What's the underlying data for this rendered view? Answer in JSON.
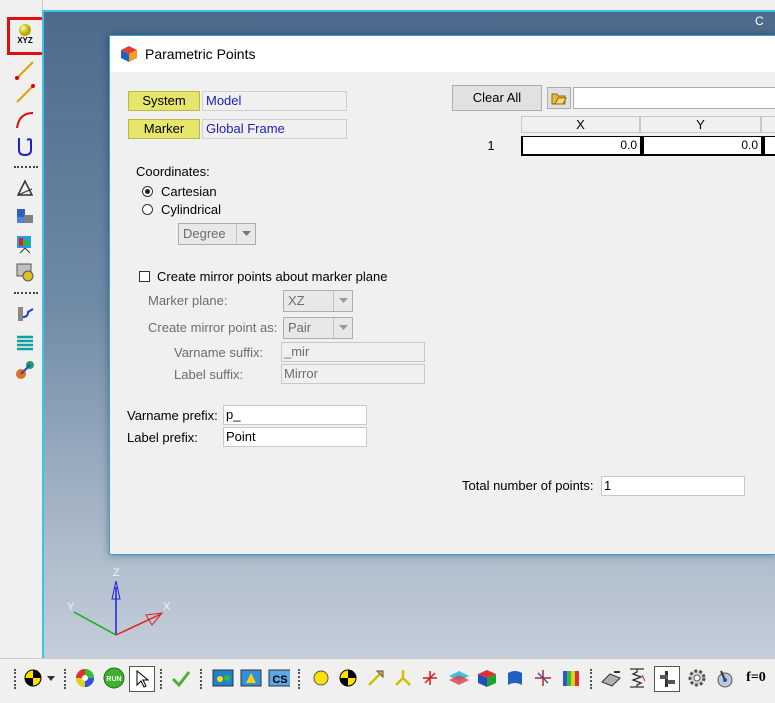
{
  "viewport": {
    "title": "C"
  },
  "triad": {
    "z_label": "Z",
    "y_label": "Y",
    "x_label": "X"
  },
  "left_toolbar": {
    "xyz_label": "XYZ",
    "icons": [
      "point-xyz-icon",
      "line-icon",
      "line2-icon",
      "arc-icon",
      "curve-icon",
      "triangle-icon",
      "surface-icon",
      "graph-icon",
      "settings-icon",
      "spring-icon",
      "stack-icon",
      "link-icon"
    ]
  },
  "dialog": {
    "title": "Parametric Points",
    "system": {
      "button": "System",
      "value": "Model"
    },
    "marker": {
      "button": "Marker",
      "value": "Global Frame"
    },
    "coordinates": {
      "label": "Coordinates:",
      "cartesian": "Cartesian",
      "cylindrical": "Cylindrical",
      "angle_unit": "Degree"
    },
    "mirror": {
      "checkbox_label": "Create mirror points about marker plane",
      "plane_label": "Marker plane:",
      "plane_value": "XZ",
      "as_label": "Create mirror point as:",
      "as_value": "Pair",
      "varname_suffix_label": "Varname suffix:",
      "varname_suffix_value": "_mir",
      "label_suffix_label": "Label suffix:",
      "label_suffix_value": "Mirror"
    },
    "varname_prefix_label": "Varname prefix:",
    "varname_prefix_value": "p_",
    "label_prefix_label": "Label prefix:",
    "label_prefix_value": "Point",
    "clear_all": "Clear All",
    "table": {
      "columns": [
        "X",
        "Y"
      ],
      "rows": [
        {
          "num": "1",
          "x": "0.0",
          "y": "0.0"
        }
      ]
    },
    "total_label": "Total number of points:",
    "total_value": "1"
  },
  "bottom_toolbar": {
    "run_label": "RUN",
    "cs_label": "CS",
    "f0_label": "f=0"
  }
}
